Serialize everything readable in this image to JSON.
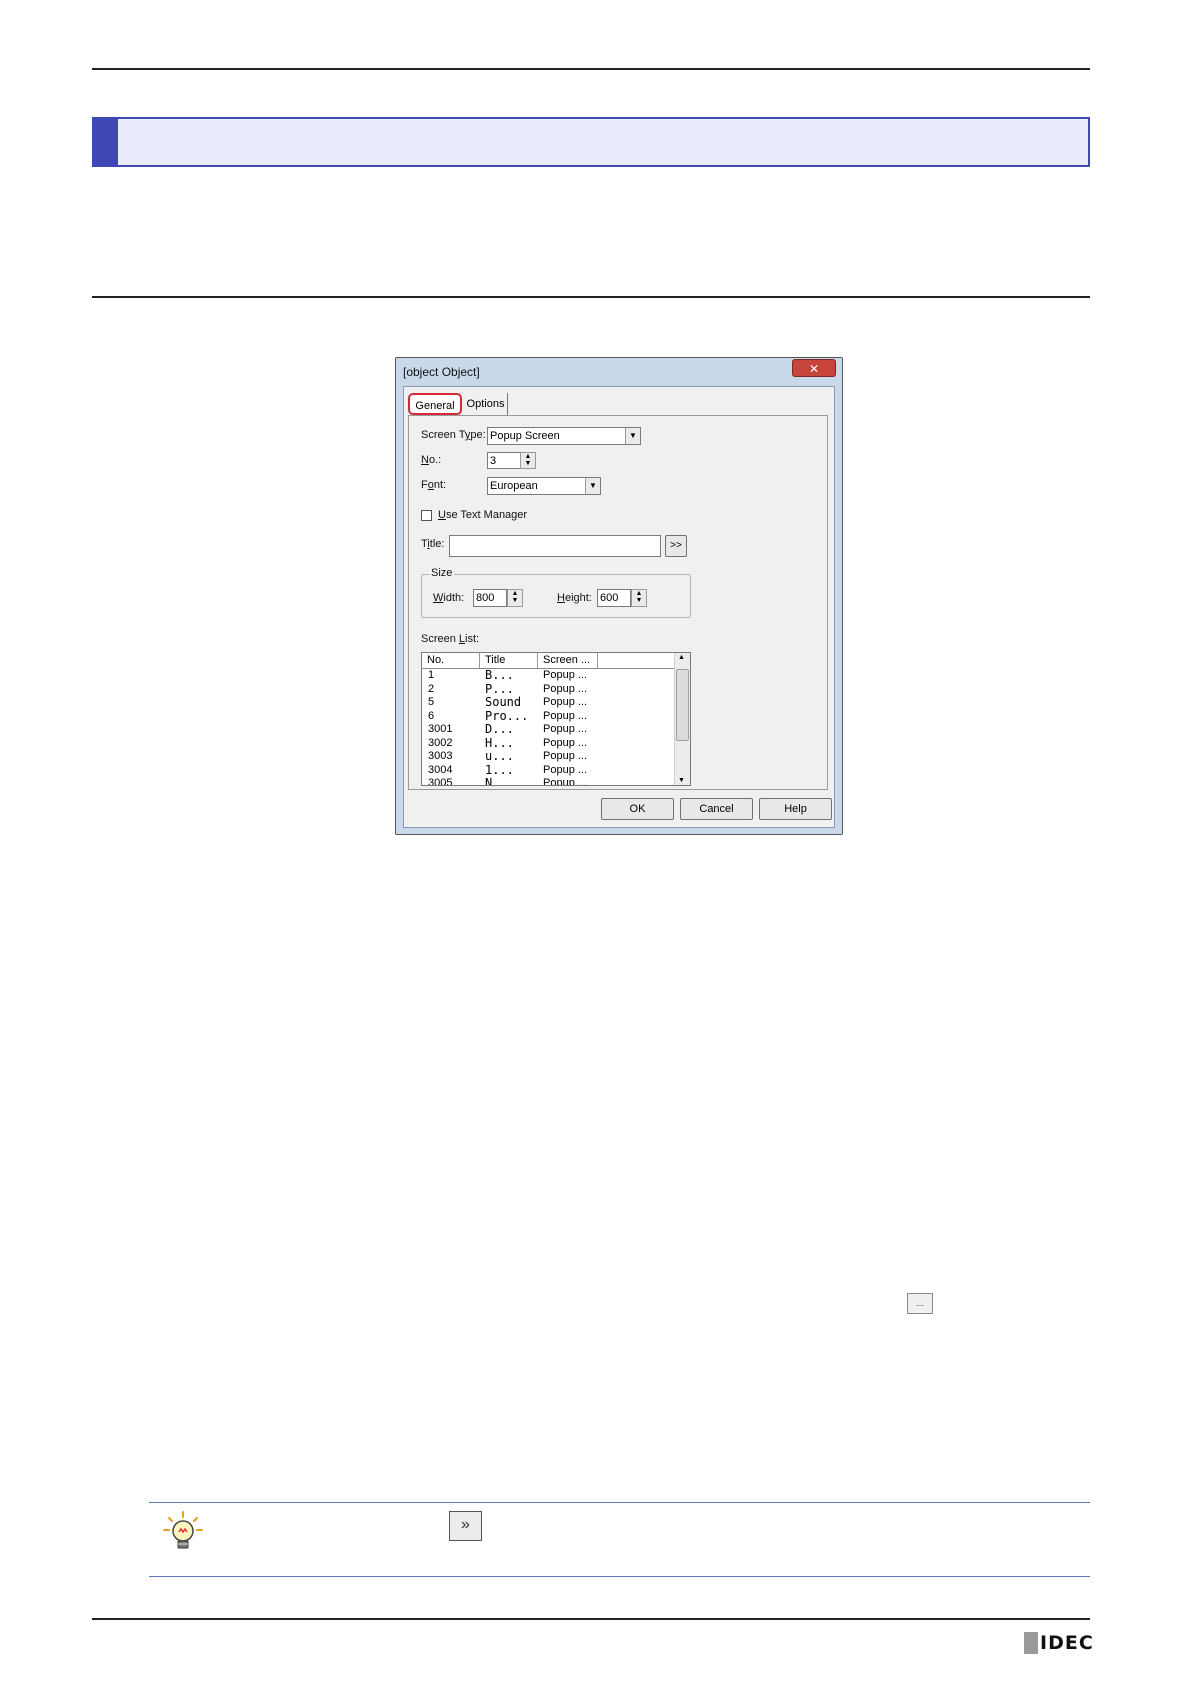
{
  "dialog": {
    "title": {
      "label_pre": "T",
      "label_u": "i",
      "label_post": "tle:",
      "value": "",
      "browse": ">>"
    },
    "close_glyph": "✕",
    "tabs": [
      {
        "label": "General"
      },
      {
        "label": "Options"
      }
    ],
    "screen_type": {
      "label_pre": "Screen T",
      "label_u": "y",
      "label_post": "pe:",
      "value": "Popup Screen"
    },
    "no": {
      "label_u": "N",
      "label_post": "o.:",
      "value": "3"
    },
    "font": {
      "label_pre": "F",
      "label_u": "o",
      "label_post": "nt:",
      "value": "European"
    },
    "use_text_manager": {
      "label_u": "U",
      "label_post": "se Text Manager",
      "checked": false
    },
    "size": {
      "group_label": "Size",
      "width": {
        "label_u": "W",
        "label_post": "idth:",
        "value": "800"
      },
      "height": {
        "label_u": "H",
        "label_post": "eight:",
        "value": "600"
      }
    },
    "screen_list": {
      "label_pre": "Screen ",
      "label_u": "L",
      "label_post": "ist:",
      "columns": [
        "No.",
        "Title",
        "Screen ..."
      ],
      "rows": [
        {
          "no": "1",
          "title": "B...",
          "screen": "Popup ..."
        },
        {
          "no": "2",
          "title": "P...",
          "screen": "Popup ..."
        },
        {
          "no": "5",
          "title": "Sound",
          "screen": "Popup ..."
        },
        {
          "no": "6",
          "title": "Pro...",
          "screen": "Popup ..."
        },
        {
          "no": "3001",
          "title": "D...",
          "screen": "Popup ..."
        },
        {
          "no": "3002",
          "title": "H...",
          "screen": "Popup ..."
        },
        {
          "no": "3003",
          "title": "u...",
          "screen": "Popup ..."
        },
        {
          "no": "3004",
          "title": "1...",
          "screen": "Popup ..."
        },
        {
          "no": "3005",
          "title": "N...",
          "screen": "Popup ..."
        }
      ]
    },
    "buttons": {
      "ok": "OK",
      "cancel": "Cancel",
      "help": "Help"
    }
  },
  "inline_button": "...",
  "tip": {
    "icon": "lightbulb-icon",
    "forward_button": "»"
  },
  "footer": {
    "logo": "IDEC"
  }
}
